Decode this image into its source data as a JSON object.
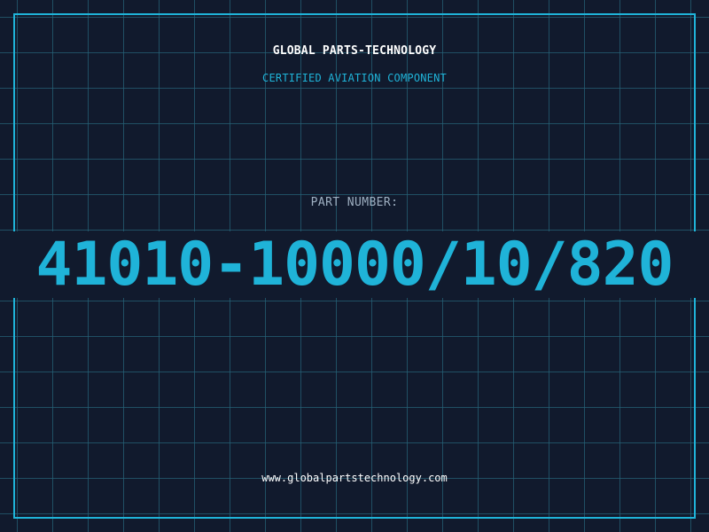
{
  "header": {
    "company": "GLOBAL PARTS-TECHNOLOGY",
    "tagline": "CERTIFIED AVIATION COMPONENT"
  },
  "part": {
    "label": "PART NUMBER:",
    "number": "41010-10000/10/820"
  },
  "footer": {
    "website": "www.globalpartstechnology.com"
  },
  "colors": {
    "background": "#111a2d",
    "grid": "#266076",
    "accent": "#1fb3d8",
    "text": "#ffffff",
    "muted": "#9fb0c2"
  }
}
